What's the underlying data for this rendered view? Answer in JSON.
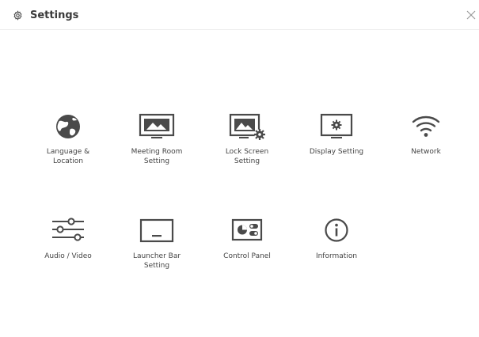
{
  "header": {
    "title": "Settings",
    "icon": "gear-icon",
    "close_icon": "close-icon"
  },
  "tiles": [
    {
      "label": "Language &\nLocation",
      "icon": "globe-icon"
    },
    {
      "label": "Meeting Room\nSetting",
      "icon": "monitor-landscape-icon"
    },
    {
      "label": "Lock Screen\nSetting",
      "icon": "monitor-landscape-gear-icon"
    },
    {
      "label": "Display Setting",
      "icon": "monitor-gear-icon"
    },
    {
      "label": "Network",
      "icon": "wifi-icon"
    },
    {
      "label": "Audio / Video",
      "icon": "sliders-icon"
    },
    {
      "label": "Launcher Bar\nSetting",
      "icon": "launcher-bar-icon"
    },
    {
      "label": "Control Panel",
      "icon": "control-panel-icon"
    },
    {
      "label": "Information",
      "icon": "info-icon"
    }
  ],
  "colors": {
    "icon": "#4a4a4a",
    "text": "#444444",
    "divider": "#ececec"
  }
}
